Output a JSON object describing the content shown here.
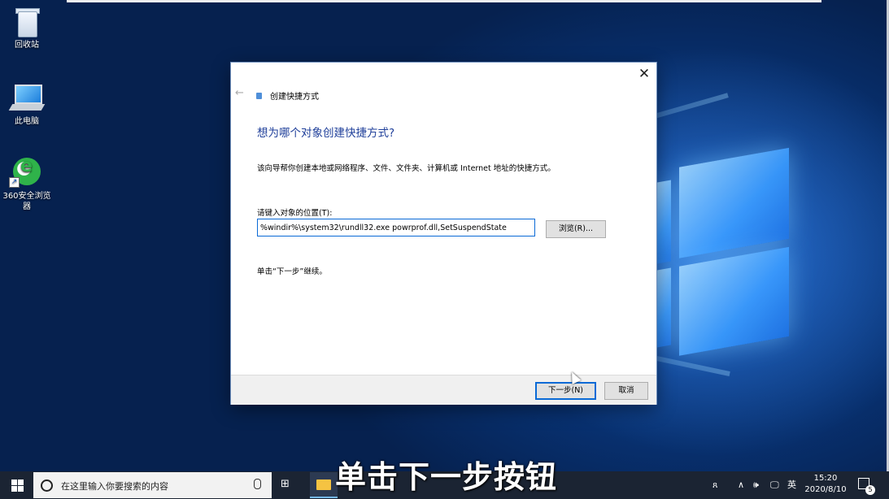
{
  "desktop": {
    "icons": [
      {
        "label": "回收站"
      },
      {
        "label": "此电脑"
      },
      {
        "label": "360安全浏览器"
      }
    ]
  },
  "dialog": {
    "close_glyph": "✕",
    "back_glyph": "←",
    "title": "创建快捷方式",
    "heading": "想为哪个对象创建快捷方式?",
    "description": "该向导帮你创建本地或网络程序、文件、文件夹、计算机或 Internet 地址的快捷方式。",
    "location_label": "请键入对象的位置(T):",
    "location_value": "%windir%\\system32\\rundll32.exe powrprof.dll,SetSuspendState",
    "browse_label": "浏览(R)...",
    "hint": "单击“下一步”继续。",
    "next_label": "下一步(N)",
    "cancel_label": "取消"
  },
  "subtitle": "单击下一步按钮",
  "taskbar": {
    "search_placeholder": "在这里输入你要搜索的内容",
    "tray_people": "ጸ",
    "tray_chevron": "∧",
    "tray_volume": "🕪",
    "tray_network": "🖵",
    "tray_lang": "英",
    "time": "15:20",
    "date": "2020/8/10",
    "notification_count": "5"
  }
}
